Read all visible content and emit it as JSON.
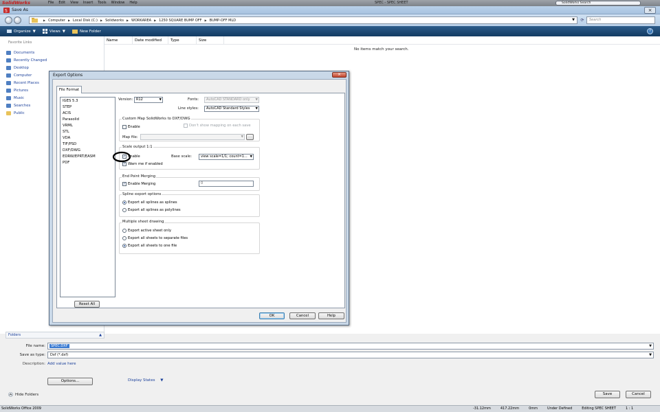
{
  "solidworks": {
    "logo": "SolidWorks",
    "menu": [
      "File",
      "Edit",
      "View",
      "Insert",
      "Tools",
      "Window",
      "Help"
    ],
    "title": "SPEC - SPEC SHEET",
    "search": "SolidWorks Search"
  },
  "window": {
    "title": "Save As",
    "breadcrumb": [
      "Computer",
      "Local Disk (C:)",
      "Solidworks",
      "WORKAREA",
      "1250 SQUARE BUMP OFF",
      "BUMP-OFF MLD"
    ],
    "search_placeholder": "Search"
  },
  "toolbar": {
    "organize": "Organize",
    "views": "Views",
    "new_folder": "New Folder"
  },
  "nav": {
    "favorites_label": "Favorite Links",
    "items": [
      "Documents",
      "Recently Changed",
      "Desktop",
      "Computer",
      "Recent Places",
      "Pictures",
      "Music",
      "Searches",
      "Public"
    ]
  },
  "columns": [
    "Name",
    "Date modified",
    "Type",
    "Size"
  ],
  "empty_message": "No items match your search.",
  "folders_label": "Folders",
  "file_name": {
    "label": "File name:",
    "value": "SPEC.DXF"
  },
  "save_as_type": {
    "label": "Save as type:",
    "value": "Dxf (*.dxf)"
  },
  "description": {
    "label": "Description:",
    "value": "Add value here"
  },
  "options_button": "Options...",
  "display_states": "Display States",
  "hide_folders": "Hide Folders",
  "save_button": "Save",
  "cancel_button": "Cancel",
  "status": {
    "app": "SolidWorks Office 2009",
    "x": "-31.12mm",
    "y": "417.22mm",
    "z": "0mm",
    "state": "Under Defined",
    "editing": "Editing SPEC SHEET",
    "scale": "1 : 1"
  },
  "dialog": {
    "title": "Export Options",
    "tab": "File Format",
    "formats": [
      "IGES 5.3",
      "STEP",
      "ACIS",
      "Parasolid",
      "VRML",
      "STL",
      "VDA",
      "TIF/PSD",
      "DXF/DWG",
      "EDRW/EPRT/EASM",
      "PDF"
    ],
    "reset_all": "Reset All",
    "version_label": "Version:",
    "version_value": "R12",
    "fonts_label": "Fonts:",
    "fonts_value": "AutoCAD STANDARD only",
    "line_styles_label": "Line styles:",
    "line_styles_value": "AutoCAD Standard Styles",
    "custom_map": {
      "title": "Custom Map SolidWorks to DXF/DWG",
      "enable": "Enable",
      "dont_show": "Don't show mapping on each save",
      "map_file_label": "Map file:",
      "browse": "..."
    },
    "scale": {
      "title": "Scale output 1:1",
      "enable": "Enable",
      "base_scale_label": "Base scale:",
      "base_scale_value": "view scale=1/1; count=1...",
      "warn": "Warn me if enabled"
    },
    "end_point": {
      "title": "End Point Merging",
      "enable": "Enable Merging",
      "value": "0"
    },
    "spline": {
      "title": "Spline export options",
      "opt1": "Export all splines as splines",
      "opt2": "Export all splines as polylines"
    },
    "multisheet": {
      "title": "Multiple sheet drawing",
      "opt1": "Export active sheet only",
      "opt2": "Export all sheets to separate files",
      "opt3": "Export all sheets to one file"
    },
    "ok": "OK",
    "cancel": "Cancel",
    "help": "Help"
  }
}
